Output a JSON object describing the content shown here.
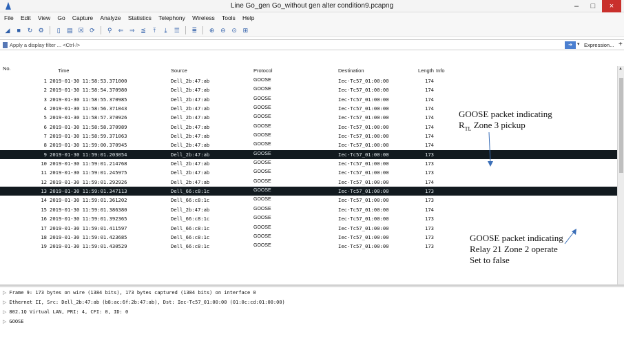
{
  "window": {
    "title": "Line Go_gen Go_without gen alter condition9.pcapng",
    "minimize_glyph": "–",
    "maximize_glyph": "□",
    "close_glyph": "×"
  },
  "menu": [
    "File",
    "Edit",
    "View",
    "Go",
    "Capture",
    "Analyze",
    "Statistics",
    "Telephony",
    "Wireless",
    "Tools",
    "Help"
  ],
  "toolbar_icons": [
    "shark-fin-icon",
    "stop-icon",
    "restart-icon",
    "options-gear-icon",
    "open-file-icon",
    "save-icon",
    "close-file-icon",
    "reload-icon",
    "find-icon",
    "go-back-icon",
    "go-forward-icon",
    "go-to-packet-icon",
    "first-packet-icon",
    "last-packet-icon",
    "autoscroll-icon",
    "colorize-icon",
    "zoom-in-icon",
    "zoom-out-icon",
    "normal-size-icon",
    "resize-columns-icon"
  ],
  "filter": {
    "placeholder": "Apply a display filter ... <Ctrl-/>",
    "expression_label": "Expression...",
    "plus_label": "+"
  },
  "columns": {
    "no": "No.",
    "time": "Time",
    "source": "Source",
    "protocol": "Protocol",
    "destination": "Destination",
    "length": "Length",
    "info": "Info"
  },
  "packets": [
    {
      "no": "1",
      "time": "2019-01-30 11:58:53.371000",
      "source": "Dell_2b:47:ab",
      "protocol": "GOOSE",
      "destination": "Iec-Tc57_01:00:00",
      "length": "174",
      "selected": false
    },
    {
      "no": "2",
      "time": "2019-01-30 11:58:54.370980",
      "source": "Dell_2b:47:ab",
      "protocol": "GOOSE",
      "destination": "Iec-Tc57_01:00:00",
      "length": "174",
      "selected": false
    },
    {
      "no": "3",
      "time": "2019-01-30 11:58:55.370985",
      "source": "Dell_2b:47:ab",
      "protocol": "GOOSE",
      "destination": "Iec-Tc57_01:00:00",
      "length": "174",
      "selected": false
    },
    {
      "no": "4",
      "time": "2019-01-30 11:58:56.371043",
      "source": "Dell_2b:47:ab",
      "protocol": "GOOSE",
      "destination": "Iec-Tc57_01:00:00",
      "length": "174",
      "selected": false
    },
    {
      "no": "5",
      "time": "2019-01-30 11:58:57.370926",
      "source": "Dell_2b:47:ab",
      "protocol": "GOOSE",
      "destination": "Iec-Tc57_01:00:00",
      "length": "174",
      "selected": false
    },
    {
      "no": "6",
      "time": "2019-01-30 11:58:58.370989",
      "source": "Dell_2b:47:ab",
      "protocol": "GOOSE",
      "destination": "Iec-Tc57_01:00:00",
      "length": "174",
      "selected": false
    },
    {
      "no": "7",
      "time": "2019-01-30 11:58:59.371063",
      "source": "Dell_2b:47:ab",
      "protocol": "GOOSE",
      "destination": "Iec-Tc57_01:00:00",
      "length": "174",
      "selected": false
    },
    {
      "no": "8",
      "time": "2019-01-30 11:59:00.370945",
      "source": "Dell_2b:47:ab",
      "protocol": "GOOSE",
      "destination": "Iec-Tc57_01:00:00",
      "length": "174",
      "selected": false
    },
    {
      "no": "9",
      "time": "2019-01-30 11:59:01.203054",
      "source": "Dell_2b:47:ab",
      "protocol": "GOOSE",
      "destination": "Iec-Tc57_01:00:00",
      "length": "173",
      "selected": true
    },
    {
      "no": "10",
      "time": "2019-01-30 11:59:01.214768",
      "source": "Dell_2b:47:ab",
      "protocol": "GOOSE",
      "destination": "Iec-Tc57_01:00:00",
      "length": "173",
      "selected": false
    },
    {
      "no": "11",
      "time": "2019-01-30 11:59:01.245975",
      "source": "Dell_2b:47:ab",
      "protocol": "GOOSE",
      "destination": "Iec-Tc57_01:00:00",
      "length": "173",
      "selected": false
    },
    {
      "no": "12",
      "time": "2019-01-30 11:59:01.292926",
      "source": "Dell_2b:47:ab",
      "protocol": "GOOSE",
      "destination": "Iec-Tc57_01:00:00",
      "length": "174",
      "selected": false
    },
    {
      "no": "13",
      "time": "2019-01-30 11:59:01.347113",
      "source": "Dell_66:c8:1c",
      "protocol": "GOOSE",
      "destination": "Iec-Tc57_01:00:00",
      "length": "173",
      "selected": true
    },
    {
      "no": "14",
      "time": "2019-01-30 11:59:01.361202",
      "source": "Dell_66:c8:1c",
      "protocol": "GOOSE",
      "destination": "Iec-Tc57_01:00:00",
      "length": "173",
      "selected": false
    },
    {
      "no": "15",
      "time": "2019-01-30 11:59:01.386380",
      "source": "Dell_2b:47:ab",
      "protocol": "GOOSE",
      "destination": "Iec-Tc57_01:00:00",
      "length": "174",
      "selected": false
    },
    {
      "no": "16",
      "time": "2019-01-30 11:59:01.392365",
      "source": "Dell_66:c8:1c",
      "protocol": "GOOSE",
      "destination": "Iec-Tc57_01:00:00",
      "length": "173",
      "selected": false
    },
    {
      "no": "17",
      "time": "2019-01-30 11:59:01.411597",
      "source": "Dell_66:c8:1c",
      "protocol": "GOOSE",
      "destination": "Iec-Tc57_01:00:00",
      "length": "173",
      "selected": false
    },
    {
      "no": "18",
      "time": "2019-01-30 11:59:01.423685",
      "source": "Dell_66:c8:1c",
      "protocol": "GOOSE",
      "destination": "Iec-Tc57_01:00:00",
      "length": "173",
      "selected": false
    },
    {
      "no": "19",
      "time": "2019-01-30 11:59:01.430529",
      "source": "Dell_66:c8:1c",
      "protocol": "GOOSE",
      "destination": "Iec-Tc57_01:00:00",
      "length": "173",
      "selected": false
    }
  ],
  "annotations": {
    "top_line1": "GOOSE packet indicating",
    "top_line2_main": "R",
    "top_line2_sub": "TL",
    "top_line2_rest": " Zone 3 pickup",
    "bottom_line1": "GOOSE packet indicating",
    "bottom_line2": "Relay 21 Zone 2 operate",
    "bottom_line3": "Set to false"
  },
  "details": [
    "Frame 9: 173 bytes on wire (1384 bits), 173 bytes captured (1384 bits) on interface 0",
    "Ethernet II, Src: Dell_2b:47:ab (b8:ac:6f:2b:47:ab), Dst: Iec-Tc57_01:00:00 (01:0c:cd:01:00:00)",
    "802.1Q Virtual LAN, PRI: 4, CFI: 0, ID: 0",
    "GOOSE"
  ],
  "colors": {
    "selected_row_bg": "#121a1f",
    "close_button": "#c9302c",
    "toolbar_icon": "#2d5da8"
  }
}
